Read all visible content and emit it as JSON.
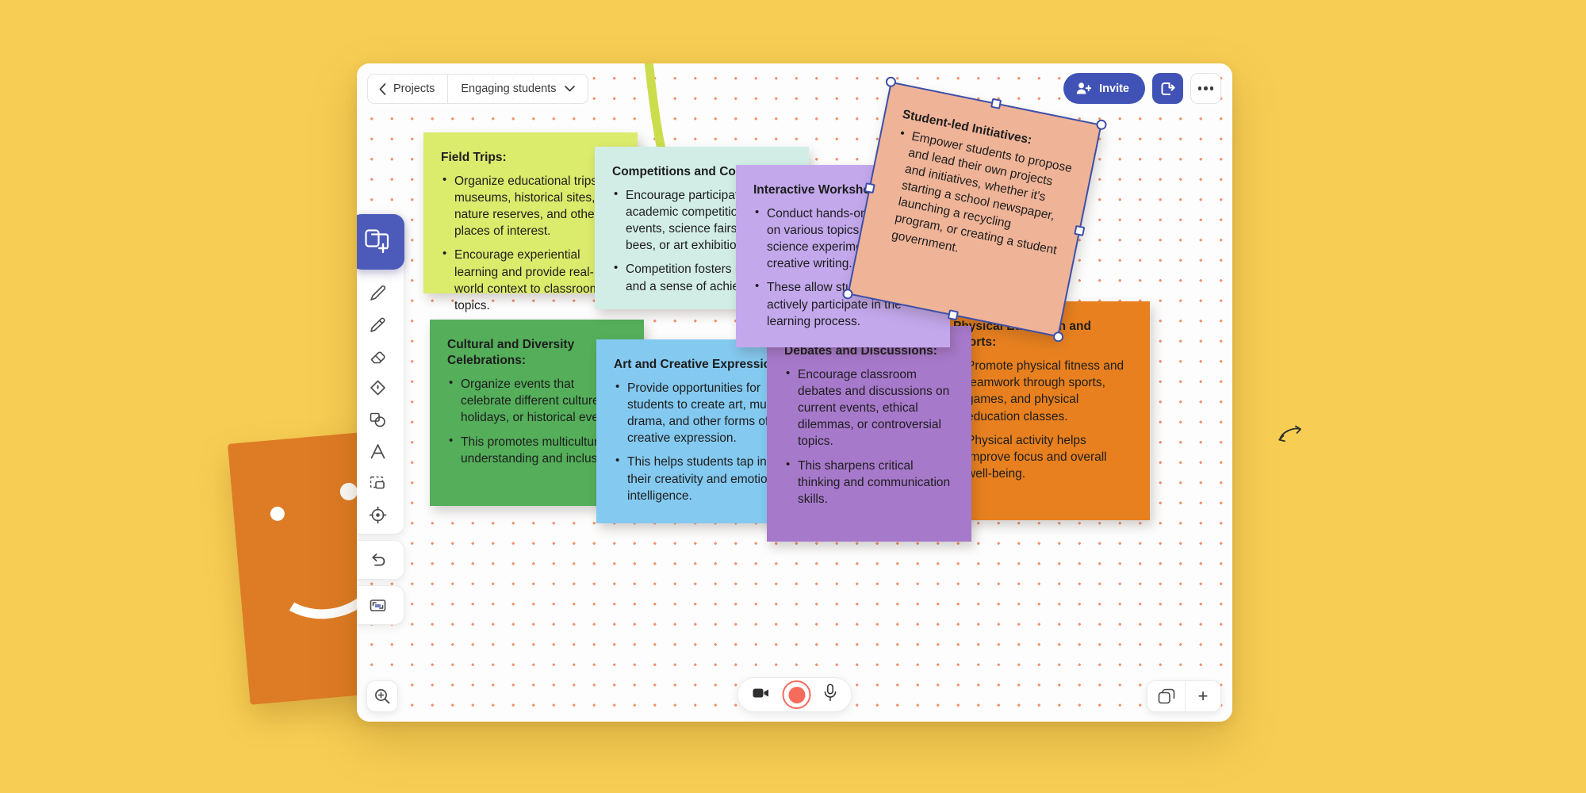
{
  "app": {
    "header": {
      "back_label": "Projects",
      "back_icon": "chevron-left-icon",
      "board_title": "Engaging students",
      "board_title_chevron": "chevron-down-icon",
      "invite_label": "Invite",
      "invite_icon": "person-add-icon",
      "share_icon": "share-arrow-icon",
      "more_icon": "more-horizontal-icon",
      "accent_color": "#4052B5"
    },
    "toolbar": {
      "items": [
        {
          "name": "add-sticky-note-tool",
          "icon": "sticky-note-plus-icon",
          "active": true
        },
        {
          "name": "select-tool",
          "icon": "cursor-select-icon",
          "active": false
        },
        {
          "name": "pen-tool",
          "icon": "pencil-icon",
          "active": false
        },
        {
          "name": "highlighter-tool",
          "icon": "highlighter-icon",
          "active": false
        },
        {
          "name": "eraser-tool",
          "icon": "eraser-icon",
          "active": false
        },
        {
          "name": "fill-tool",
          "icon": "paint-bucket-icon",
          "active": false
        },
        {
          "name": "shapes-tool",
          "icon": "shapes-icon",
          "active": false
        },
        {
          "name": "text-tool",
          "icon": "text-a-icon",
          "active": false
        },
        {
          "name": "frame-tool",
          "icon": "frame-select-icon",
          "active": false
        },
        {
          "name": "laser-pointer-tool",
          "icon": "target-crosshair-icon",
          "active": false
        },
        {
          "name": "undo-tool",
          "icon": "undo-arrow-icon",
          "active": false
        },
        {
          "name": "screen-capture-tool",
          "icon": "screen-capture-icon",
          "active": false
        }
      ]
    },
    "bottom_bar": {
      "zoom_icon": "zoom-in-magnifier-icon",
      "camera_icon": "video-camera-icon",
      "record_icon": "record-button-icon",
      "mic_icon": "microphone-icon",
      "pages_icon": "pages-stack-icon",
      "add_page_label": "+"
    },
    "selection": {
      "outline_color": "#3E4FA8",
      "rotate_cursor_icon": "rotate-cursor-icon"
    },
    "canvas": {
      "background": "#FDFDFD",
      "dot_color": "#F0936E",
      "ink_stroke_color": "#CBDD4D"
    }
  },
  "notes": {
    "field_trips": {
      "title": "Field Trips:",
      "color": "#DBEB6B",
      "bullets": [
        "Organize educational trips to museums, historical sites, nature reserves, and other places of interest.",
        "Encourage experiential learning and provide real-world context to classroom topics."
      ]
    },
    "competitions": {
      "title": "Competitions and Contests:",
      "color": "#D2EDE6",
      "bullets": [
        "Encourage participation in academic competitions, sports events, science fairs, spelling bees, or art exhibitions.",
        "Competition fosters motivation and a sense of achievement."
      ]
    },
    "workshops": {
      "title": "Interactive Workshops:",
      "color": "#C3A8EC",
      "bullets": [
        "Conduct hands-on workshops on various topics, from science experiments to creative writing.",
        "These allow students to actively participate in the learning process."
      ]
    },
    "student_led": {
      "title": "Student-led Initiatives:",
      "color": "#EFB498",
      "bullets": [
        "Empower students to propose and lead their own projects and initiatives, whether it's starting a school newspaper, launching a recycling program, or creating a student government."
      ]
    },
    "physical_education": {
      "title": "Physical Education and Sports:",
      "color": "#E8801F",
      "bullets": [
        "Promote physical fitness and teamwork through sports, games, and physical education classes.",
        "Physical activity helps improve focus and overall well-being."
      ]
    },
    "cultural": {
      "title": "Cultural and Diversity Celebrations:",
      "color": "#54AE5A",
      "bullets": [
        "Organize events that celebrate different cultures, holidays, or historical events.",
        "This promotes multicultural understanding and inclusivity."
      ]
    },
    "art": {
      "title": "Art and Creative Expression:",
      "color": "#84C9F0",
      "bullets": [
        "Provide opportunities for students to create art, music, drama, and other forms of creative expression.",
        "This helps students tap into their creativity and emotional intelligence."
      ]
    },
    "debates": {
      "title": "Debates and Discussions:",
      "color": "#A779CB",
      "bullets": [
        "Encourage classroom debates and discussions on current events, ethical dilemmas, or controversial topics.",
        "This sharpens critical thinking and communication skills."
      ]
    }
  },
  "background_card": {
    "name": "smiley-card",
    "color": "#DE7B25",
    "face_icon": "smiley-face-icon"
  }
}
